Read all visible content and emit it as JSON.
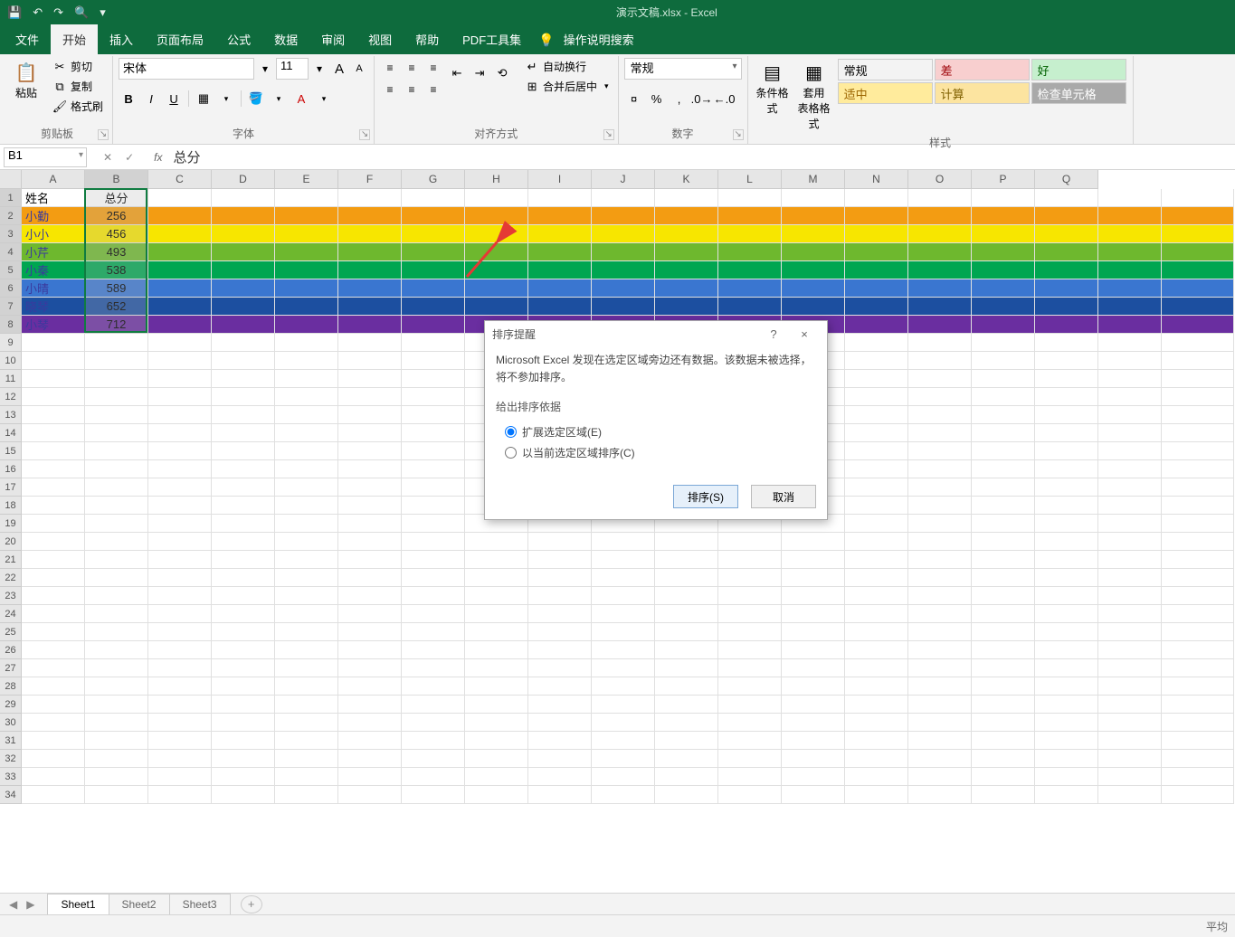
{
  "titlebar": {
    "title": "演示文稿.xlsx  -  Excel"
  },
  "tabs": {
    "file": "文件",
    "home": "开始",
    "insert": "插入",
    "layout": "页面布局",
    "formulas": "公式",
    "data": "数据",
    "review": "审阅",
    "view": "视图",
    "help": "帮助",
    "pdf": "PDF工具集",
    "tell_me": "操作说明搜索"
  },
  "ribbon": {
    "clipboard": {
      "group": "剪贴板",
      "paste": "粘贴",
      "cut": "剪切",
      "copy": "复制",
      "format_painter": "格式刷"
    },
    "font": {
      "group": "字体",
      "name": "宋体",
      "size": "11"
    },
    "alignment": {
      "group": "对齐方式",
      "wrap": "自动换行",
      "merge": "合并后居中"
    },
    "number": {
      "group": "数字",
      "format": "常规"
    },
    "styles": {
      "group": "样式",
      "cond_fmt": "条件格式",
      "table_fmt": "套用\n表格格式",
      "normal": "常规",
      "bad": "差",
      "good": "好",
      "neutral": "适中",
      "calc": "计算",
      "check": "检查单元格"
    }
  },
  "formula_bar": {
    "name_box": "B1",
    "fx_value": "总分"
  },
  "columns": [
    "A",
    "B",
    "C",
    "D",
    "E",
    "F",
    "G",
    "H",
    "I",
    "J",
    "K",
    "L",
    "M",
    "N",
    "O",
    "P",
    "Q"
  ],
  "sheet": {
    "headers": [
      "姓名",
      "总分"
    ],
    "rows": [
      {
        "name": "小勤",
        "score": "256",
        "bg": "#f39c12"
      },
      {
        "name": "小小",
        "score": "456",
        "bg": "#f7e600"
      },
      {
        "name": "小芹",
        "score": "493",
        "bg": "#6eb82e"
      },
      {
        "name": "小秦",
        "score": "538",
        "bg": "#00a651"
      },
      {
        "name": "小晴",
        "score": "589",
        "bg": "#3a76d0"
      },
      {
        "name": "晓琴",
        "score": "652",
        "bg": "#1c4fa0"
      },
      {
        "name": "小琴",
        "score": "712",
        "bg": "#6a2ea0"
      }
    ]
  },
  "dialog": {
    "title": "排序提醒",
    "message": "Microsoft Excel 发现在选定区域旁边还有数据。该数据未被选择，将不参加排序。",
    "section": "给出排序依据",
    "opt_expand": "扩展选定区域(E)",
    "opt_current": "以当前选定区域排序(C)",
    "btn_sort": "排序(S)",
    "btn_cancel": "取消",
    "help": "?",
    "close": "×"
  },
  "sheet_tabs": {
    "s1": "Sheet1",
    "s2": "Sheet2",
    "s3": "Sheet3"
  },
  "status": {
    "right": "平均"
  },
  "style_colors": {
    "normal_bg": "#ffffff",
    "bad_bg": "#f8cfcf",
    "good_bg": "#c6efce",
    "neutral_bg": "#ffeb9c",
    "calc_bg": "#fce4a0",
    "check_bg": "#a9a9a9"
  }
}
